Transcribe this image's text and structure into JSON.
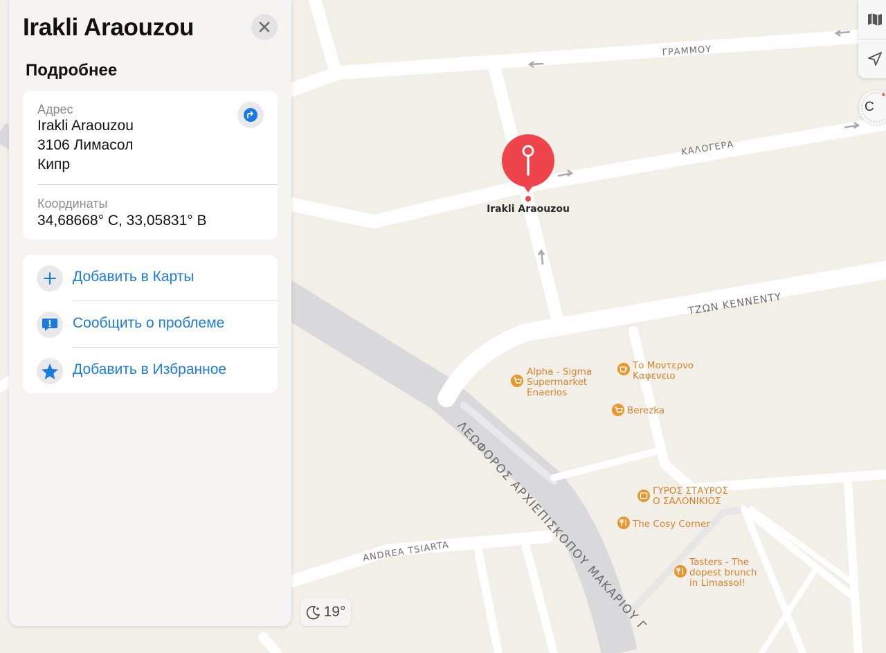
{
  "place": {
    "title": "Irakli Araouzou"
  },
  "details": {
    "heading": "Подробнее",
    "address_label": "Адрес",
    "address_lines": [
      "Irakli Araouzou",
      "3106 Лимасол",
      "Кипр"
    ],
    "coordinates_label": "Координаты",
    "coordinates_value": "34,68668° С, 33,05831° В"
  },
  "actions": [
    {
      "label": "Добавить в Карты",
      "icon": "plus-icon"
    },
    {
      "label": "Сообщить о проблеме",
      "icon": "report-problem-icon"
    },
    {
      "label": "Добавить в Избранное",
      "icon": "star-icon"
    }
  ],
  "map": {
    "pin_label": "Irakli Araouzou",
    "streets": [
      "ΓΡΑΜΜΟΥ",
      "ΚΑΛΟΓΕΡΑ",
      "ΤΖΩΝ KENNENTY",
      "ΛΕΩΦΟΡΟΣ ΑΡΧΙΕΠΙΣΚΟΠΟΥ ΜΑΚΑΡΙΟΥ Γ",
      "ANDREA TSIARTA"
    ],
    "pois": [
      {
        "lines": [
          "Alpha - Sigma",
          "Supermarket",
          "Enaerios"
        ],
        "icon": "cart-icon"
      },
      {
        "lines": [
          "Το Μοντερνο",
          "Καφενειο"
        ],
        "icon": "coffee-icon"
      },
      {
        "lines": [
          "Berezka"
        ],
        "icon": "cart-icon"
      },
      {
        "lines": [
          "ΓΥΡΟΣ ΣΤΑΥΡΟΣ",
          "Ο ΣΑΛΟΝΙΚΙΟΣ"
        ],
        "icon": "takeaway-icon"
      },
      {
        "lines": [
          "The Cosy Corner"
        ],
        "icon": "fork-knife-icon"
      },
      {
        "lines": [
          "Tasters - The",
          "dopest brunch",
          "in Limassol!"
        ],
        "icon": "fork-knife-icon"
      }
    ],
    "poi_color": "#e8962e",
    "pin_color": "#f0444c",
    "accent_color": "#1a7ae0"
  },
  "controls": {
    "compass_letter": "С"
  },
  "weather": {
    "temperature": "19°",
    "icon": "moon-icon"
  }
}
